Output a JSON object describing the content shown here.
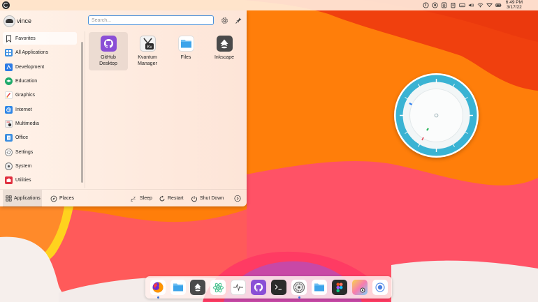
{
  "menu": {
    "username": "vince",
    "search_placeholder": "Search...",
    "categories": [
      {
        "label": "Favorites"
      },
      {
        "label": "All Applications"
      },
      {
        "label": "Development"
      },
      {
        "label": "Education"
      },
      {
        "label": "Graphics"
      },
      {
        "label": "Internet"
      },
      {
        "label": "Multimedia"
      },
      {
        "label": "Office"
      },
      {
        "label": "Settings"
      },
      {
        "label": "System"
      },
      {
        "label": "Utilities"
      }
    ],
    "apps": [
      {
        "line1": "GitHub",
        "line2": "Desktop"
      },
      {
        "line1": "Kvantum",
        "line2": "Manager"
      },
      {
        "line1": "Files",
        "line2": ""
      },
      {
        "line1": "Inkscape",
        "line2": ""
      }
    ],
    "footer": {
      "applications": "Applications",
      "places": "Places",
      "sleep": "Sleep",
      "restart": "Restart",
      "shutdown": "Shut Down"
    }
  },
  "topbar": {
    "time": "6:49 PM",
    "date": "3/17/22"
  },
  "colors": {
    "accent": "#4a90d9",
    "wallpaper_orange": "#ff7a00",
    "wallpaper_red": "#ff4d5a",
    "widget_teal": "#3bb8d4"
  }
}
